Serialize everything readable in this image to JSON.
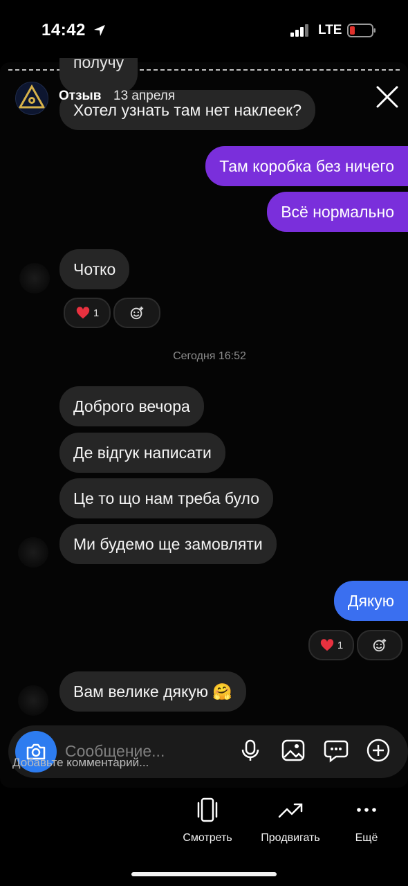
{
  "status_bar": {
    "time": "14:42",
    "network": "LTE"
  },
  "story": {
    "username": "Отзыв",
    "date": "13 апреля"
  },
  "chat": {
    "partial_top": "получу",
    "messages": [
      {
        "text": "Хотел узнать там нет наклеек?"
      },
      {
        "text": "Там коробка без ничего"
      },
      {
        "text": "Всё нормально"
      },
      {
        "text": "Чотко"
      },
      {
        "text": "Доброго вечора"
      },
      {
        "text": "Де відгук написати"
      },
      {
        "text": "Це то що нам треба було"
      },
      {
        "text": "Ми будемо ще замовляти"
      },
      {
        "text": "Дякую"
      },
      {
        "text": "Вам велике дякую 🤗"
      }
    ],
    "reaction_count_1": "1",
    "reaction_count_2": "1",
    "date_separator": "Сегодня 16:52",
    "composer_placeholder": "Сообщение..."
  },
  "comment_placeholder": "Добавьте комментарий...",
  "actions": [
    {
      "label": "Смотреть",
      "icon": "phone-rotate-icon"
    },
    {
      "label": "Продвигать",
      "icon": "trend-up-icon"
    },
    {
      "label": "Ещё",
      "icon": "more-dots-icon"
    }
  ],
  "colors": {
    "outgoing": "#7a2fdb",
    "outgoing_blue": "#3a6ff0",
    "incoming": "#262626",
    "accent_camera": "#2d7cf0",
    "battery_low": "#e0302b"
  }
}
